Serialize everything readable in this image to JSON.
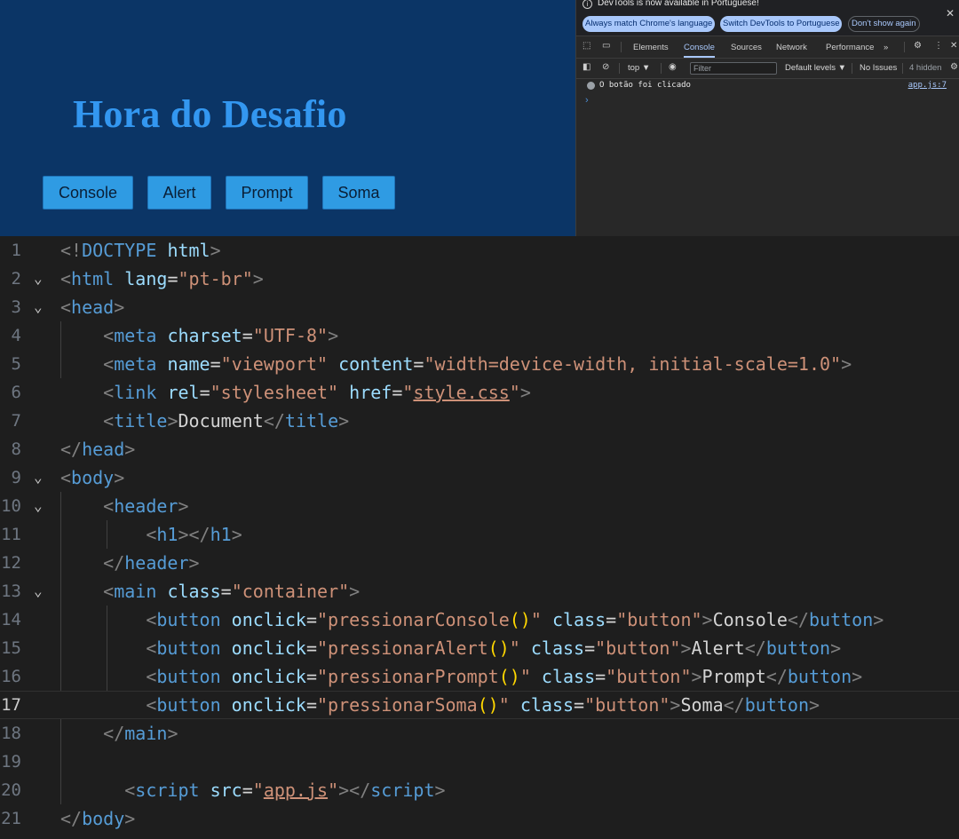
{
  "preview": {
    "heading": "Hora do Desafio",
    "buttons": [
      "Console",
      "Alert",
      "Prompt",
      "Soma"
    ]
  },
  "devtools": {
    "infobar": {
      "message": "DevTools is now available in Portuguese!",
      "always_match": "Always match Chrome's language",
      "switch": "Switch DevTools to Portuguese",
      "dont_show": "Don't show again"
    },
    "tabs": [
      "Elements",
      "Console",
      "Sources",
      "Network",
      "Performance"
    ],
    "active_tab": "Console",
    "more_tabs": "»",
    "filterbar": {
      "context": "top ▼",
      "filter_placeholder": "Filter",
      "levels": "Default levels ▼",
      "issues": "No Issues",
      "hidden": "4 hidden"
    },
    "console": {
      "message": "O botão foi clicado",
      "source": "app.js:7",
      "prompt": "›"
    }
  },
  "editor": {
    "current_line": 17,
    "lines": [
      {
        "n": "1",
        "tokens": [
          [
            "p",
            "<!"
          ],
          [
            "t",
            "DOCTYPE"
          ],
          [
            "x",
            " "
          ],
          [
            "a",
            "html"
          ],
          [
            "p",
            ">"
          ]
        ]
      },
      {
        "n": "2",
        "tokens": [
          [
            "p",
            "<"
          ],
          [
            "t",
            "html"
          ],
          [
            "x",
            " "
          ],
          [
            "a",
            "lang"
          ],
          [
            "x",
            "="
          ],
          [
            "s",
            "\"pt-br\""
          ],
          [
            "p",
            ">"
          ]
        ]
      },
      {
        "n": "3",
        "tokens": [
          [
            "p",
            "<"
          ],
          [
            "t",
            "head"
          ],
          [
            "p",
            ">"
          ]
        ]
      },
      {
        "n": "4",
        "tokens": [
          [
            "x",
            "    "
          ],
          [
            "p",
            "<"
          ],
          [
            "t",
            "meta"
          ],
          [
            "x",
            " "
          ],
          [
            "a",
            "charset"
          ],
          [
            "x",
            "="
          ],
          [
            "s",
            "\"UTF-8\""
          ],
          [
            "p",
            ">"
          ]
        ]
      },
      {
        "n": "5",
        "tokens": [
          [
            "x",
            "    "
          ],
          [
            "p",
            "<"
          ],
          [
            "t",
            "meta"
          ],
          [
            "x",
            " "
          ],
          [
            "a",
            "name"
          ],
          [
            "x",
            "="
          ],
          [
            "s",
            "\"viewport\""
          ],
          [
            "x",
            " "
          ],
          [
            "a",
            "content"
          ],
          [
            "x",
            "="
          ],
          [
            "s",
            "\"width=device-width, initial-scale=1.0\""
          ],
          [
            "p",
            ">"
          ]
        ]
      },
      {
        "n": "6",
        "tokens": [
          [
            "x",
            "    "
          ],
          [
            "p",
            "<"
          ],
          [
            "t",
            "link"
          ],
          [
            "x",
            " "
          ],
          [
            "a",
            "rel"
          ],
          [
            "x",
            "="
          ],
          [
            "s",
            "\"stylesheet\""
          ],
          [
            "x",
            " "
          ],
          [
            "a",
            "href"
          ],
          [
            "x",
            "="
          ],
          [
            "s",
            "\""
          ],
          [
            "s u",
            "style.css"
          ],
          [
            "s",
            "\""
          ],
          [
            "p",
            ">"
          ]
        ]
      },
      {
        "n": "7",
        "tokens": [
          [
            "x",
            "    "
          ],
          [
            "p",
            "<"
          ],
          [
            "t",
            "title"
          ],
          [
            "p",
            ">"
          ],
          [
            "x",
            "Document"
          ],
          [
            "p",
            "</"
          ],
          [
            "t",
            "title"
          ],
          [
            "p",
            ">"
          ]
        ]
      },
      {
        "n": "8",
        "tokens": [
          [
            "p",
            "</"
          ],
          [
            "t",
            "head"
          ],
          [
            "p",
            ">"
          ]
        ]
      },
      {
        "n": "9",
        "tokens": [
          [
            "p",
            "<"
          ],
          [
            "t",
            "body"
          ],
          [
            "p",
            ">"
          ]
        ]
      },
      {
        "n": "10",
        "tokens": [
          [
            "x",
            "    "
          ],
          [
            "p",
            "<"
          ],
          [
            "t",
            "header"
          ],
          [
            "p",
            ">"
          ]
        ]
      },
      {
        "n": "11",
        "tokens": [
          [
            "x",
            "        "
          ],
          [
            "p",
            "<"
          ],
          [
            "t",
            "h1"
          ],
          [
            "p",
            "></"
          ],
          [
            "t",
            "h1"
          ],
          [
            "p",
            ">"
          ]
        ]
      },
      {
        "n": "12",
        "tokens": [
          [
            "x",
            "    "
          ],
          [
            "p",
            "</"
          ],
          [
            "t",
            "header"
          ],
          [
            "p",
            ">"
          ]
        ]
      },
      {
        "n": "13",
        "tokens": [
          [
            "x",
            "    "
          ],
          [
            "p",
            "<"
          ],
          [
            "t",
            "main"
          ],
          [
            "x",
            " "
          ],
          [
            "a",
            "class"
          ],
          [
            "x",
            "="
          ],
          [
            "s",
            "\"container\""
          ],
          [
            "p",
            ">"
          ]
        ]
      },
      {
        "n": "14",
        "tokens": [
          [
            "x",
            "        "
          ],
          [
            "p",
            "<"
          ],
          [
            "t",
            "button"
          ],
          [
            "x",
            " "
          ],
          [
            "a",
            "onclick"
          ],
          [
            "x",
            "="
          ],
          [
            "s",
            "\"pressionarConsole"
          ],
          [
            "y",
            "()"
          ],
          [
            "s",
            "\""
          ],
          [
            "x",
            " "
          ],
          [
            "a",
            "class"
          ],
          [
            "x",
            "="
          ],
          [
            "s",
            "\"button\""
          ],
          [
            "p",
            ">"
          ],
          [
            "x",
            "Console"
          ],
          [
            "p",
            "</"
          ],
          [
            "t",
            "button"
          ],
          [
            "p",
            ">"
          ]
        ]
      },
      {
        "n": "15",
        "tokens": [
          [
            "x",
            "        "
          ],
          [
            "p",
            "<"
          ],
          [
            "t",
            "button"
          ],
          [
            "x",
            " "
          ],
          [
            "a",
            "onclick"
          ],
          [
            "x",
            "="
          ],
          [
            "s",
            "\"pressionarAlert"
          ],
          [
            "y",
            "()"
          ],
          [
            "s",
            "\""
          ],
          [
            "x",
            " "
          ],
          [
            "a",
            "class"
          ],
          [
            "x",
            "="
          ],
          [
            "s",
            "\"button\""
          ],
          [
            "p",
            ">"
          ],
          [
            "x",
            "Alert"
          ],
          [
            "p",
            "</"
          ],
          [
            "t",
            "button"
          ],
          [
            "p",
            ">"
          ]
        ]
      },
      {
        "n": "16",
        "tokens": [
          [
            "x",
            "        "
          ],
          [
            "p",
            "<"
          ],
          [
            "t",
            "button"
          ],
          [
            "x",
            " "
          ],
          [
            "a",
            "onclick"
          ],
          [
            "x",
            "="
          ],
          [
            "s",
            "\"pressionarPrompt"
          ],
          [
            "y",
            "()"
          ],
          [
            "s",
            "\""
          ],
          [
            "x",
            " "
          ],
          [
            "a",
            "class"
          ],
          [
            "x",
            "="
          ],
          [
            "s",
            "\"button\""
          ],
          [
            "p",
            ">"
          ],
          [
            "x",
            "Prompt"
          ],
          [
            "p",
            "</"
          ],
          [
            "t",
            "button"
          ],
          [
            "p",
            ">"
          ]
        ]
      },
      {
        "n": "17",
        "tokens": [
          [
            "x",
            "        "
          ],
          [
            "p",
            "<"
          ],
          [
            "t",
            "button"
          ],
          [
            "x",
            " "
          ],
          [
            "a",
            "onclick"
          ],
          [
            "x",
            "="
          ],
          [
            "s",
            "\"pressionarSoma"
          ],
          [
            "y",
            "()"
          ],
          [
            "s",
            "\""
          ],
          [
            "x",
            " "
          ],
          [
            "a",
            "class"
          ],
          [
            "x",
            "="
          ],
          [
            "s",
            "\"button\""
          ],
          [
            "p",
            ">"
          ],
          [
            "x",
            "Soma"
          ],
          [
            "p",
            "</"
          ],
          [
            "t",
            "button"
          ],
          [
            "p",
            ">"
          ]
        ]
      },
      {
        "n": "18",
        "tokens": [
          [
            "x",
            "    "
          ],
          [
            "p",
            "</"
          ],
          [
            "t",
            "main"
          ],
          [
            "p",
            ">"
          ]
        ]
      },
      {
        "n": "19",
        "tokens": []
      },
      {
        "n": "20",
        "tokens": [
          [
            "x",
            "      "
          ],
          [
            "p",
            "<"
          ],
          [
            "t",
            "script"
          ],
          [
            "x",
            " "
          ],
          [
            "a",
            "src"
          ],
          [
            "x",
            "="
          ],
          [
            "s",
            "\""
          ],
          [
            "s u",
            "app.js"
          ],
          [
            "s",
            "\""
          ],
          [
            "p",
            "></"
          ],
          [
            "t",
            "script"
          ],
          [
            "p",
            ">"
          ]
        ]
      },
      {
        "n": "21",
        "tokens": [
          [
            "p",
            "</"
          ],
          [
            "t",
            "body"
          ],
          [
            "p",
            ">"
          ]
        ]
      }
    ]
  }
}
